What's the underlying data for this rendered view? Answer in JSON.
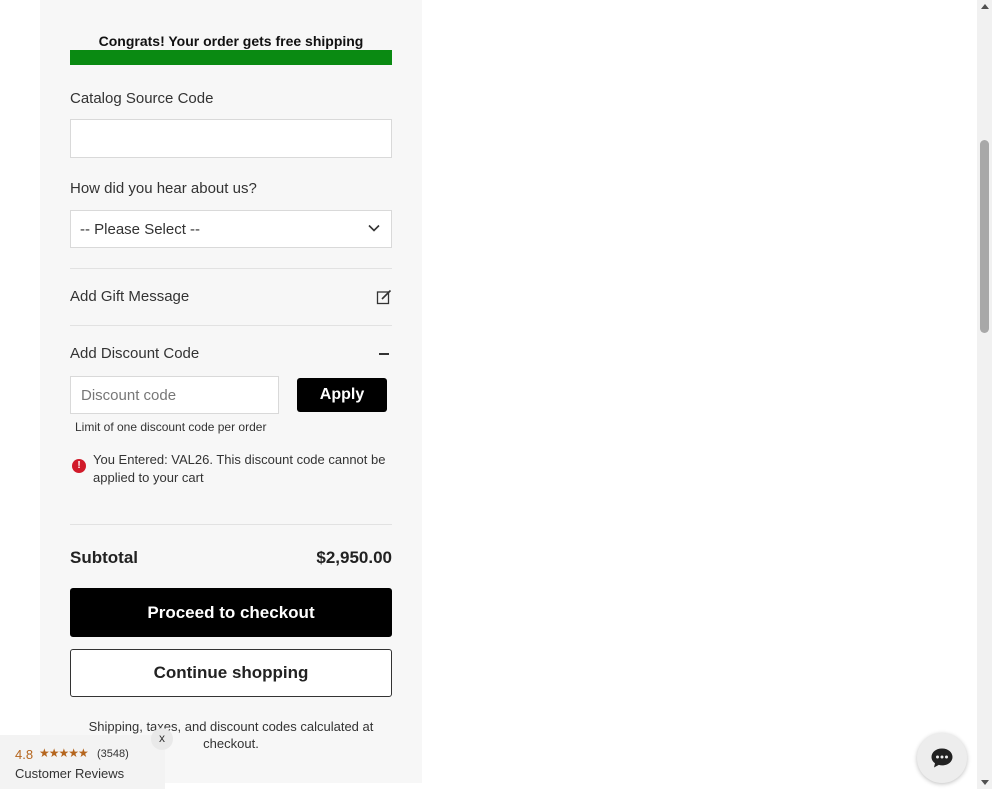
{
  "shipping": {
    "message": "Congrats! Your order gets free shipping",
    "progress_fraction": 1.0,
    "bar_color": "#0a8a12"
  },
  "catalog": {
    "label": "Catalog Source Code",
    "value": ""
  },
  "referral": {
    "label": "How did you hear about us?",
    "selected": "-- Please Select --"
  },
  "gift": {
    "label": "Add Gift Message",
    "icon": "edit-icon"
  },
  "discount": {
    "label": "Add Discount Code",
    "toggle_icon": "minus-icon",
    "placeholder": "Discount code",
    "apply_label": "Apply",
    "limit_note": "Limit of one discount code per order",
    "error_message": "You Entered: VAL26. This discount code cannot be applied to your cart",
    "error_icon_glyph": "!",
    "error_color": "#d11a2a"
  },
  "summary": {
    "subtotal_label": "Subtotal",
    "subtotal_value": "$2,950.00",
    "checkout_label": "Proceed to checkout",
    "continue_label": "Continue shopping",
    "footnote": "Shipping, taxes, and discount codes calculated at checkout."
  },
  "reviews": {
    "score": "4.8",
    "stars": "★★★★★",
    "count": "(3548)",
    "label": "Customer Reviews",
    "close_label": "x",
    "accent_color": "#b5651d"
  },
  "chat": {
    "icon": "chat-icon"
  }
}
